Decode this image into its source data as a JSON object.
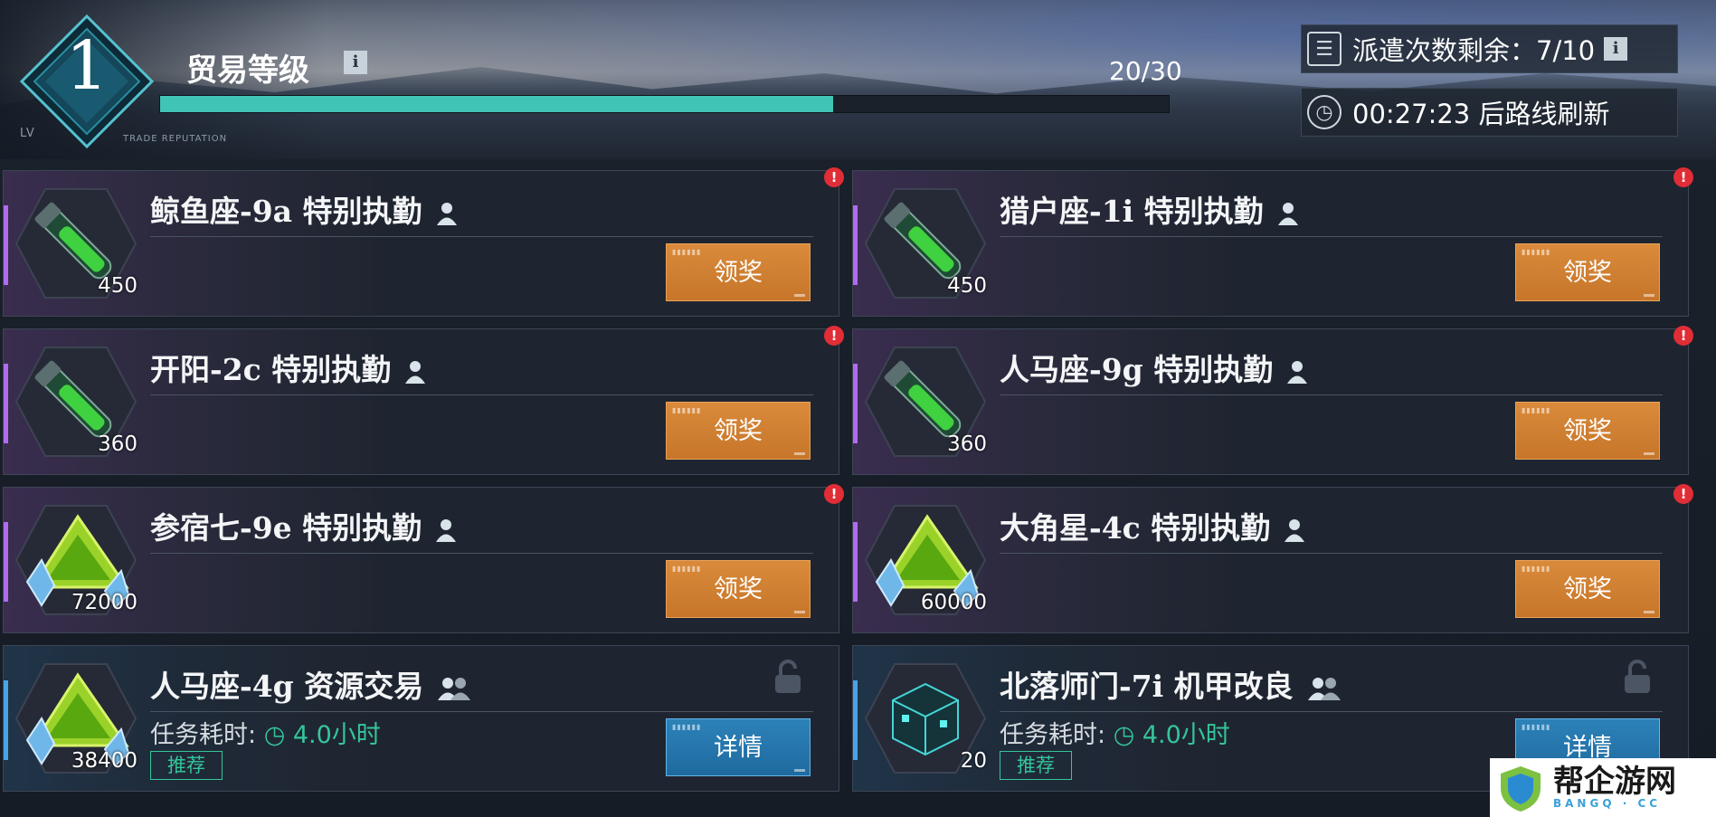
{
  "header": {
    "level": "1",
    "lv_label": "LV",
    "trade_caption": "TRADE REPUTATION",
    "title": "贸易等级",
    "info_glyph": "i",
    "xp_text": "20/30",
    "xp_progress": 0.667,
    "xp_color": "#40c4b5",
    "dispatch_label": "派遣次数剩余：7/10",
    "refresh_label": "00:27:23 后路线刷新"
  },
  "cards": [
    {
      "title": "鲸鱼座-9a 特别执勤",
      "quantity": "450",
      "item_icon": "green-vial-icon",
      "team_icon": "single-person-icon",
      "button": "领奖",
      "alert": "!"
    },
    {
      "title": "猎户座-1i 特别执勤",
      "quantity": "450",
      "item_icon": "green-vial-icon",
      "team_icon": "single-person-icon",
      "button": "领奖",
      "alert": "!"
    },
    {
      "title": "开阳-2c 特别执勤",
      "quantity": "360",
      "item_icon": "green-vial-icon",
      "team_icon": "single-person-icon",
      "button": "领奖",
      "alert": "!"
    },
    {
      "title": "人马座-9g 特别执勤",
      "quantity": "360",
      "item_icon": "green-vial-icon",
      "team_icon": "single-person-icon",
      "button": "领奖",
      "alert": "!"
    },
    {
      "title": "参宿七-9e 特别执勤",
      "quantity": "72000",
      "item_icon": "green-crystal-icon",
      "team_icon": "single-person-icon",
      "button": "领奖",
      "alert": "!"
    },
    {
      "title": "大角星-4c 特别执勤",
      "quantity": "60000",
      "item_icon": "green-crystal-icon",
      "team_icon": "single-person-icon",
      "button": "领奖",
      "alert": "!"
    },
    {
      "title": "人马座-4g 资源交易",
      "quantity": "38400",
      "item_icon": "green-crystal-icon",
      "team_icon": "group-icon",
      "duration_label": "任务耗时:",
      "duration_value": "4.0小时",
      "tag": "推荐",
      "button": "详情"
    },
    {
      "title": "北落师门-7i 机甲改良",
      "quantity": "20",
      "item_icon": "cyan-cube-icon",
      "team_icon": "group-icon",
      "duration_label": "任务耗时:",
      "duration_value": "4.0小时",
      "tag": "推荐",
      "button": "详情"
    }
  ],
  "watermark": {
    "text": "帮企游网",
    "sub": "BANGQ · CC"
  }
}
